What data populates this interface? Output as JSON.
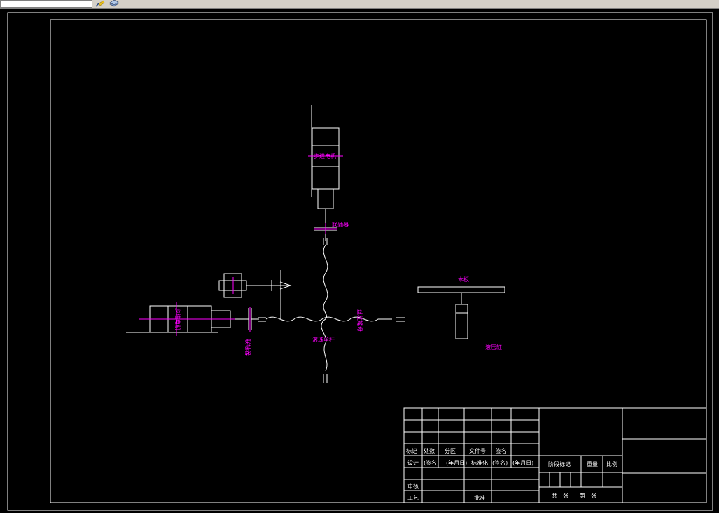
{
  "colors": {
    "background": "#000000",
    "line": "#ffffff",
    "label": "#ff00ff",
    "centerline": "#ff00ff"
  },
  "toolbar": {
    "icons": [
      "brush-icon",
      "layer-icon"
    ]
  },
  "drawing": {
    "labels": {
      "stepper_motor_top": "步进电机",
      "coupling_top": "联轴器",
      "stepper_motor_left": "步进电机",
      "coupling_left": "联轴器",
      "ball_screw": "滚珠丝杆",
      "nut": "丝杠螺母",
      "worktable": "木板",
      "cylinder": "液压缸"
    }
  },
  "title_block": {
    "header_row": [
      "标记",
      "处数",
      "分区",
      "文件号",
      "签名"
    ],
    "design_row": [
      "设计",
      "(签名)",
      "(年月日)",
      "标准化",
      "(签名)",
      "(年月日)"
    ],
    "review": "审核",
    "process": "工艺",
    "approve": "批准",
    "stage_mark": "阶段标记",
    "weight": "重量",
    "scale": "比例",
    "sheets": "共　张　　第　张"
  }
}
